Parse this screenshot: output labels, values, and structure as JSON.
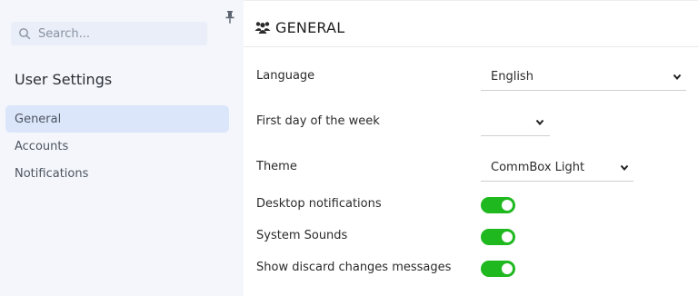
{
  "sidebar": {
    "search": {
      "placeholder": "Search..."
    },
    "title": "User Settings",
    "items": [
      {
        "label": "General",
        "active": true
      },
      {
        "label": "Accounts",
        "active": false
      },
      {
        "label": "Notifications",
        "active": false
      }
    ]
  },
  "main": {
    "header": {
      "icon": "users-icon",
      "title": "GENERAL"
    },
    "fields": {
      "language": {
        "label": "Language",
        "value": "English"
      },
      "first_day": {
        "label": "First day of the week",
        "value": ""
      },
      "theme": {
        "label": "Theme",
        "value": "CommBox Light"
      },
      "desktop_notifications": {
        "label": "Desktop notifications",
        "enabled": true
      },
      "system_sounds": {
        "label": "System Sounds",
        "enabled": true
      },
      "discard_messages": {
        "label": "Show discard changes messages",
        "enabled": true
      }
    }
  },
  "colors": {
    "toggle_on": "#1fb81f",
    "active_nav": "#dce6fb",
    "sidebar_bg": "#f4f6fb"
  }
}
